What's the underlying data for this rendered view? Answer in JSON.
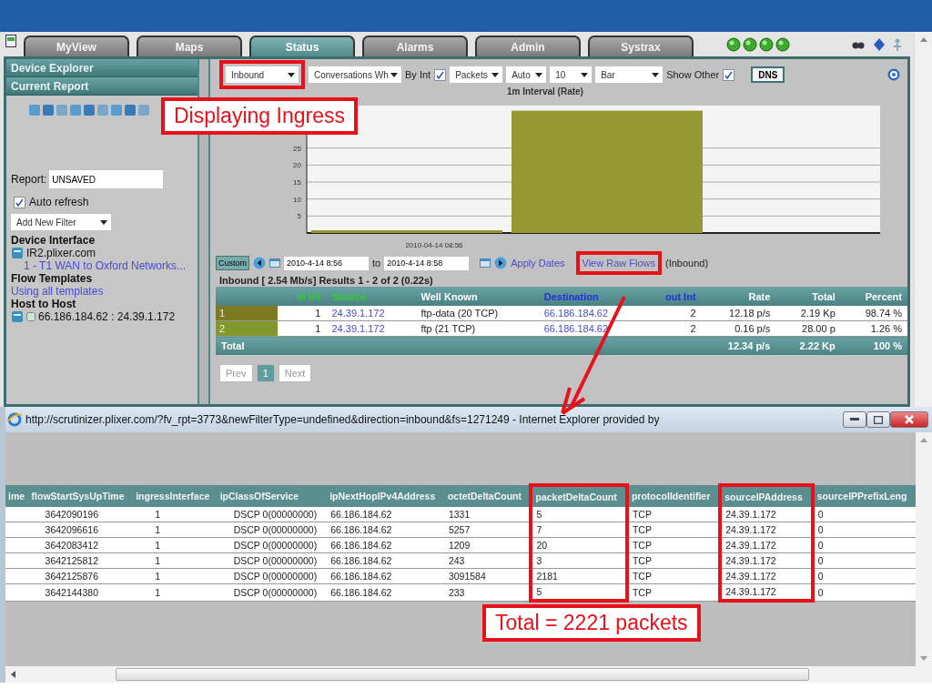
{
  "tabs": [
    {
      "label": "MyView",
      "selected": false
    },
    {
      "label": "Maps",
      "selected": false
    },
    {
      "label": "Status",
      "selected": true
    },
    {
      "label": "Alarms",
      "selected": false
    },
    {
      "label": "Admin",
      "selected": false
    },
    {
      "label": "Systrax",
      "selected": false
    }
  ],
  "sidebar": {
    "sections": [
      "Device Explorer",
      "Current Report"
    ],
    "report_label": "Report:",
    "report_value": "UNSAVED",
    "auto_refresh": {
      "label": "Auto refresh",
      "checked": true
    },
    "filter_select": "Add New Filter",
    "groups": [
      {
        "heading": "Device Interface",
        "items": [
          {
            "kind": "device",
            "text": "IR2.plixer.com"
          },
          {
            "kind": "link",
            "text": "1 - T1 WAN to Oxford Networks..."
          }
        ]
      },
      {
        "heading": "Flow Templates",
        "items": [
          {
            "kind": "link",
            "text": "Using all templates"
          }
        ]
      },
      {
        "heading": "Host to Host",
        "items": [
          {
            "kind": "host",
            "text": "66.186.184.62 : 24.39.1.172"
          }
        ]
      }
    ]
  },
  "toolbar": [
    {
      "kind": "select",
      "text": "Inbound",
      "highlighted": true
    },
    {
      "kind": "select",
      "text": "Conversations Wh",
      "highlighted": false
    },
    {
      "kind": "checkbox",
      "text": "By Int",
      "checked": true
    },
    {
      "kind": "select",
      "text": "Packets",
      "highlighted": false
    },
    {
      "kind": "select",
      "text": "Auto",
      "highlighted": false
    },
    {
      "kind": "select",
      "text": "10",
      "highlighted": false
    },
    {
      "kind": "select",
      "text": "Bar",
      "highlighted": false
    },
    {
      "kind": "checkbox",
      "text": "Show Other",
      "checked": true
    },
    {
      "kind": "button",
      "text": "DNS"
    }
  ],
  "chart_data": {
    "type": "bar",
    "title": "1m Interval (Rate)",
    "ylim": [
      0,
      37.5
    ],
    "yticks": [
      5,
      10,
      15,
      20,
      25
    ],
    "grid": true,
    "categories": [
      "2010-04-14 08:56",
      null
    ],
    "series": [
      {
        "color": "#959833",
        "values": [
          0.8,
          36
        ]
      }
    ]
  },
  "date_bar": {
    "range_button": "Custom",
    "from": "2010-4-14 8:56",
    "to_label": "to",
    "to": "2010-4-14 8:58",
    "apply": "Apply Dates",
    "raw_flows": "View Raw Flows",
    "raw_flows_highlighted": true,
    "raw_flows_note": "(Inbound)"
  },
  "summary": "Inbound [ 2.54 Mb/s] Results 1 - 2 of 2 (0.22s)",
  "table": {
    "columns": [
      {
        "kind": "index"
      },
      {
        "kind": "number",
        "label": "in Int"
      },
      {
        "kind": "link",
        "label": "Source"
      },
      {
        "kind": "text",
        "label": "Well Known"
      },
      {
        "kind": "link",
        "label": "Destination"
      },
      {
        "kind": "number",
        "label": "out Int"
      },
      {
        "kind": "number",
        "label": "Rate"
      },
      {
        "kind": "number",
        "label": "Total"
      },
      {
        "kind": "number",
        "label": "Percent"
      }
    ],
    "rows": [
      {
        "color": "#7d7a22",
        "cells": [
          "1",
          "1",
          "24.39.1.172",
          "ftp-data (20 TCP)",
          "66.186.184.62",
          "2",
          "12.18 p/s",
          "2.19 Kp",
          "98.74 %"
        ]
      },
      {
        "color": "#7f9a2a",
        "cells": [
          "2",
          "1",
          "24.39.1.172",
          "ftp (21 TCP)",
          "66.186.184.62",
          "2",
          "0.16 p/s",
          "28.00 p",
          "1.26 %"
        ]
      }
    ],
    "total": {
      "label": "Total",
      "rate": "12.34 p/s",
      "total": "2.22 Kp",
      "percent": "100 %"
    }
  },
  "pager": [
    {
      "label": "Prev",
      "selected": false
    },
    {
      "label": "1",
      "selected": true
    },
    {
      "label": "Next",
      "selected": false
    }
  ],
  "popup": {
    "title": "http://scrutinizer.plixer.com/?fv_rpt=3773&newFilterType=undefined&direction=inbound&fs=1271249 - Internet Explorer provided by",
    "columns": [
      {
        "label": "ime",
        "highlighted": false
      },
      {
        "label": "flowStartSysUpTime",
        "highlighted": false
      },
      {
        "label": "ingressInterface",
        "highlighted": false
      },
      {
        "label": "ipClassOfService",
        "highlighted": false
      },
      {
        "label": "ipNextHopIPv4Address",
        "highlighted": false
      },
      {
        "label": "octetDeltaCount",
        "highlighted": false
      },
      {
        "label": "packetDeltaCount",
        "highlighted": true
      },
      {
        "label": "protocolIdentifier",
        "highlighted": false
      },
      {
        "label": "sourceIPAddress",
        "highlighted": true
      },
      {
        "label": "sourceIPPrefixLeng",
        "highlighted": false
      }
    ],
    "rows": [
      [
        "",
        "3642090196",
        "1",
        "DSCP 0(00000000)",
        "66.186.184.62",
        "1331",
        "5",
        "TCP",
        "24.39.1.172",
        "0"
      ],
      [
        "",
        "3642096616",
        "1",
        "DSCP 0(00000000)",
        "66.186.184.62",
        "5257",
        "7",
        "TCP",
        "24.39.1.172",
        "0"
      ],
      [
        "",
        "3642083412",
        "1",
        "DSCP 0(00000000)",
        "66.186.184.62",
        "1209",
        "20",
        "TCP",
        "24.39.1.172",
        "0"
      ],
      [
        "",
        "3642125812",
        "1",
        "DSCP 0(00000000)",
        "66.186.184.62",
        "243",
        "3",
        "TCP",
        "24.39.1.172",
        "0"
      ],
      [
        "",
        "3642125876",
        "1",
        "DSCP 0(00000000)",
        "66.186.184.62",
        "3091584",
        "2181",
        "TCP",
        "24.39.1.172",
        "0"
      ],
      [
        "",
        "3642144380",
        "1",
        "DSCP 0(00000000)",
        "66.186.184.62",
        "233",
        "5",
        "TCP",
        "24.39.1.172",
        "0"
      ]
    ]
  },
  "annotations": [
    {
      "text": "Displaying Ingress"
    },
    {
      "text": "Total = 2221 packets"
    }
  ]
}
